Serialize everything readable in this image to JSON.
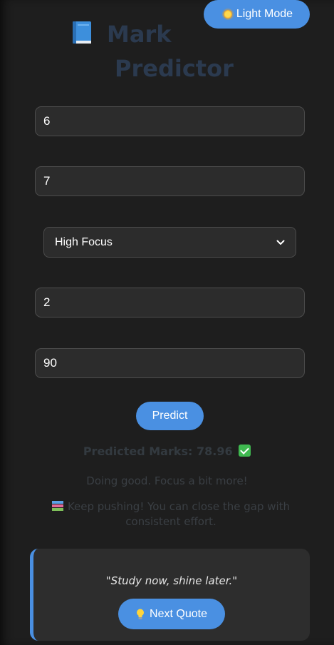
{
  "header": {
    "theme_toggle_label": "Light Mode",
    "theme_toggle_icon": "sun-icon",
    "title_line1": "Mark",
    "title_line2": "Predictor",
    "title_icon": "blue-book-icon"
  },
  "form": {
    "field1_value": "6",
    "field2_value": "7",
    "focus_select_value": "High Focus",
    "field3_value": "2",
    "field4_value": "90",
    "predict_label": "Predict"
  },
  "result": {
    "predicted_text": "Predicted Marks: 78.96",
    "status_icon": "check-mark-icon",
    "message": "Doing good. Focus a bit more!",
    "advice_icon": "books-icon",
    "advice": "Keep pushing! You can close the gap with consistent effort."
  },
  "quote": {
    "text": "\"Study now, shine later.\"",
    "next_label": "Next Quote",
    "next_icon": "light-bulb-icon"
  },
  "colors": {
    "accent": "#4a90e2",
    "background": "#1e1e1e",
    "input_bg": "#2c2c2c",
    "card_bg": "#2d2d2d"
  }
}
